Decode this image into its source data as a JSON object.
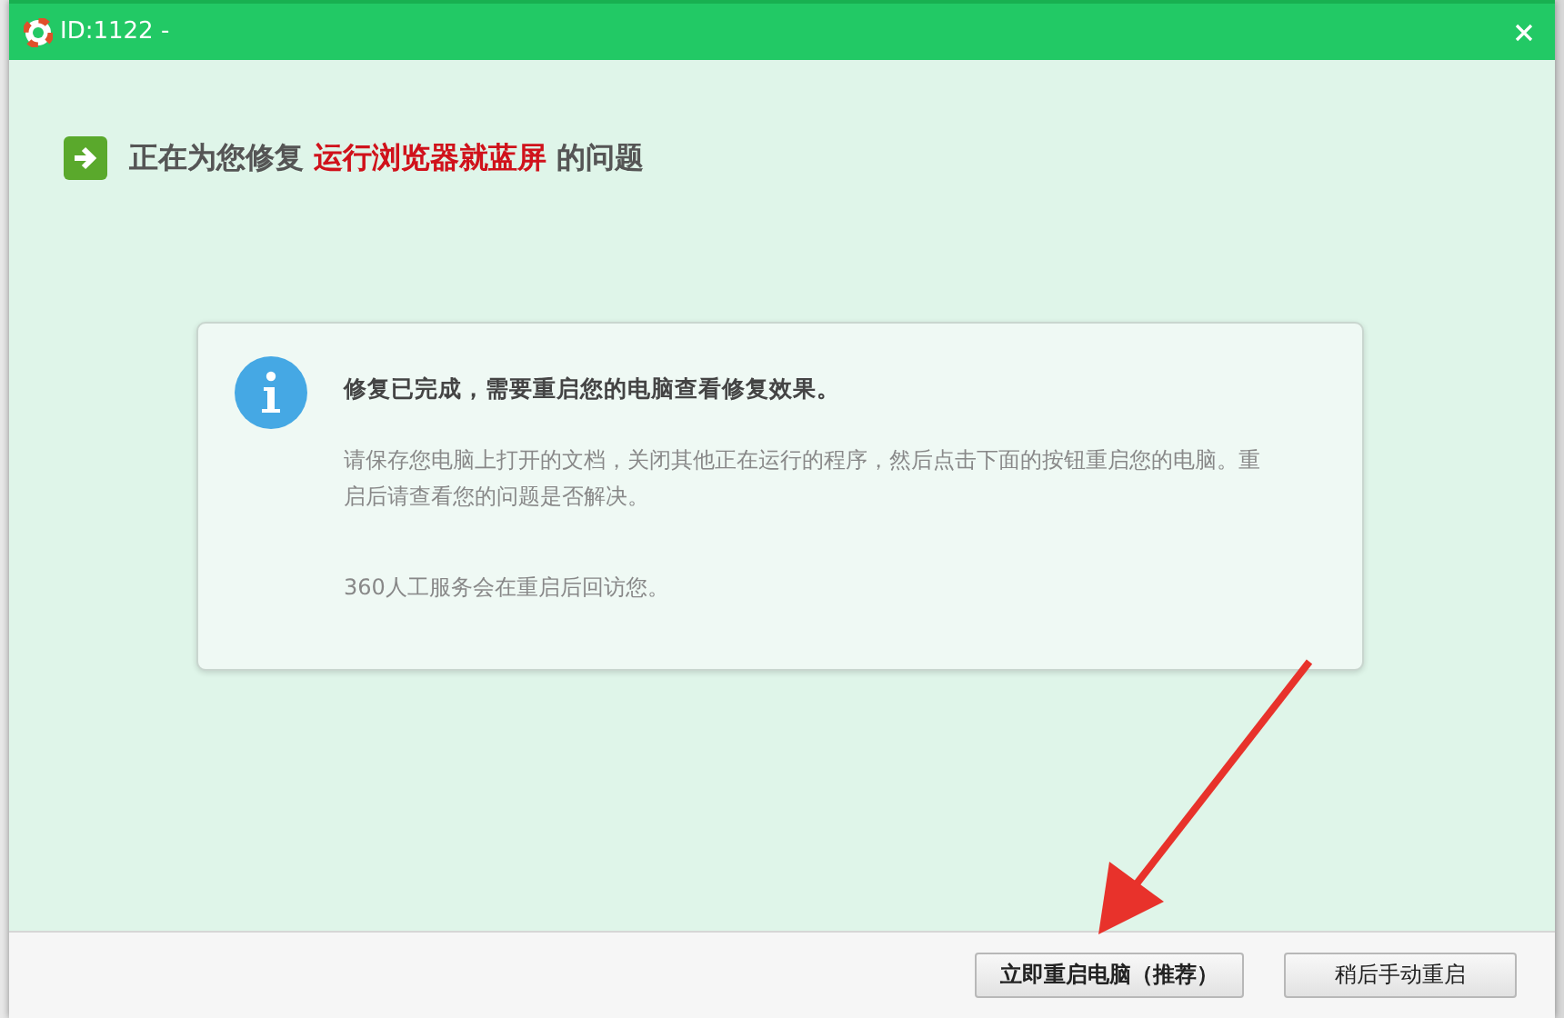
{
  "window": {
    "title": "ID:1122 -"
  },
  "heading": {
    "prefix": "正在为您修复",
    "issue": "运行浏览器就蓝屏",
    "suffix": "的问题"
  },
  "message": {
    "title": "修复已完成，需要重启您的电脑查看修复效果。",
    "body": "请保存您电脑上打开的文档，关闭其他正在运行的程序，然后点击下面的按钮重启您的电脑。重启后请查看您的问题是否解决。",
    "note": "360人工服务会在重启后回访您。"
  },
  "buttons": [
    {
      "label": "立即重启电脑（推荐）"
    },
    {
      "label": "稍后手动重启"
    }
  ]
}
